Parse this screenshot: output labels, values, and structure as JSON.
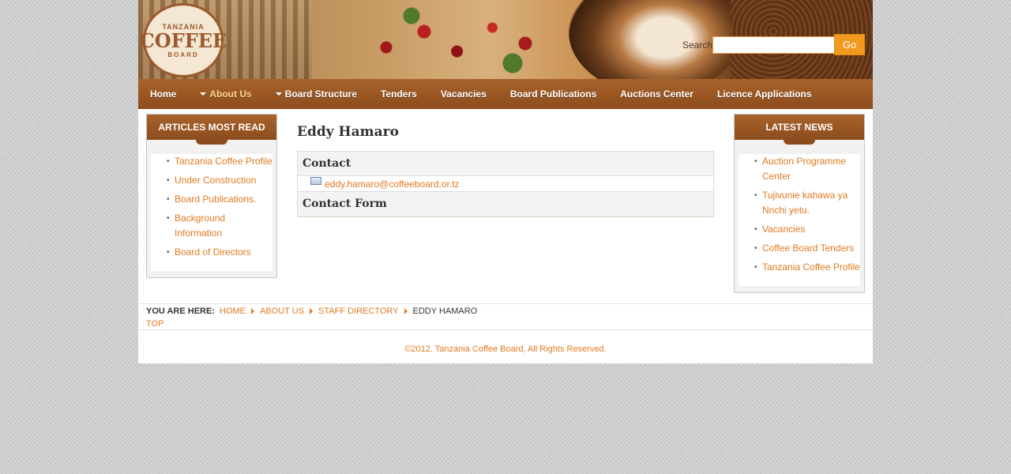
{
  "header": {
    "logo": {
      "top": "TANZANIA",
      "main": "COFFEE",
      "bottom": "BOARD"
    },
    "search": {
      "label": "Search",
      "value": "",
      "button": "Go"
    }
  },
  "nav": {
    "items": [
      {
        "label": "Home",
        "caret": false
      },
      {
        "label": "About Us",
        "caret": true,
        "active": true
      },
      {
        "label": "Board Structure",
        "caret": true
      },
      {
        "label": "Tenders",
        "caret": false
      },
      {
        "label": "Vacancies",
        "caret": false
      },
      {
        "label": "Board Publications",
        "caret": false
      },
      {
        "label": "Auctions Center",
        "caret": false
      },
      {
        "label": "Licence Applications",
        "caret": false
      }
    ]
  },
  "left_module": {
    "title": "ARTICLES MOST READ",
    "items": [
      "Tanzania Coffee Profile",
      "Under Construction",
      "Board Publications.",
      "Background Information",
      "Board of Directors"
    ]
  },
  "right_module": {
    "title": "LATEST NEWS",
    "items": [
      "Auction Programme Center",
      "Tujivunie kahawa ya Nnchi yetu.",
      "Vacancies",
      "Coffee Board Tenders",
      "Tanzania Coffee Profile"
    ]
  },
  "content": {
    "title": "Eddy Hamaro",
    "contact_heading": "Contact",
    "email": "eddy.hamaro@coffeeboard.or.tz",
    "form_heading": "Contact Form"
  },
  "breadcrumb": {
    "lead": "YOU ARE HERE:",
    "links": [
      "HOME",
      "ABOUT US",
      "STAFF DIRECTORY"
    ],
    "current": "EDDY HAMARO",
    "top": "TOP"
  },
  "footer": {
    "text": "©2012. Tanzania Coffee Board, All Rights Reserved."
  },
  "colors": {
    "nav_brown": "#8c4c1d",
    "link_orange": "#e07a1f",
    "go_button": "#f29a1e"
  }
}
